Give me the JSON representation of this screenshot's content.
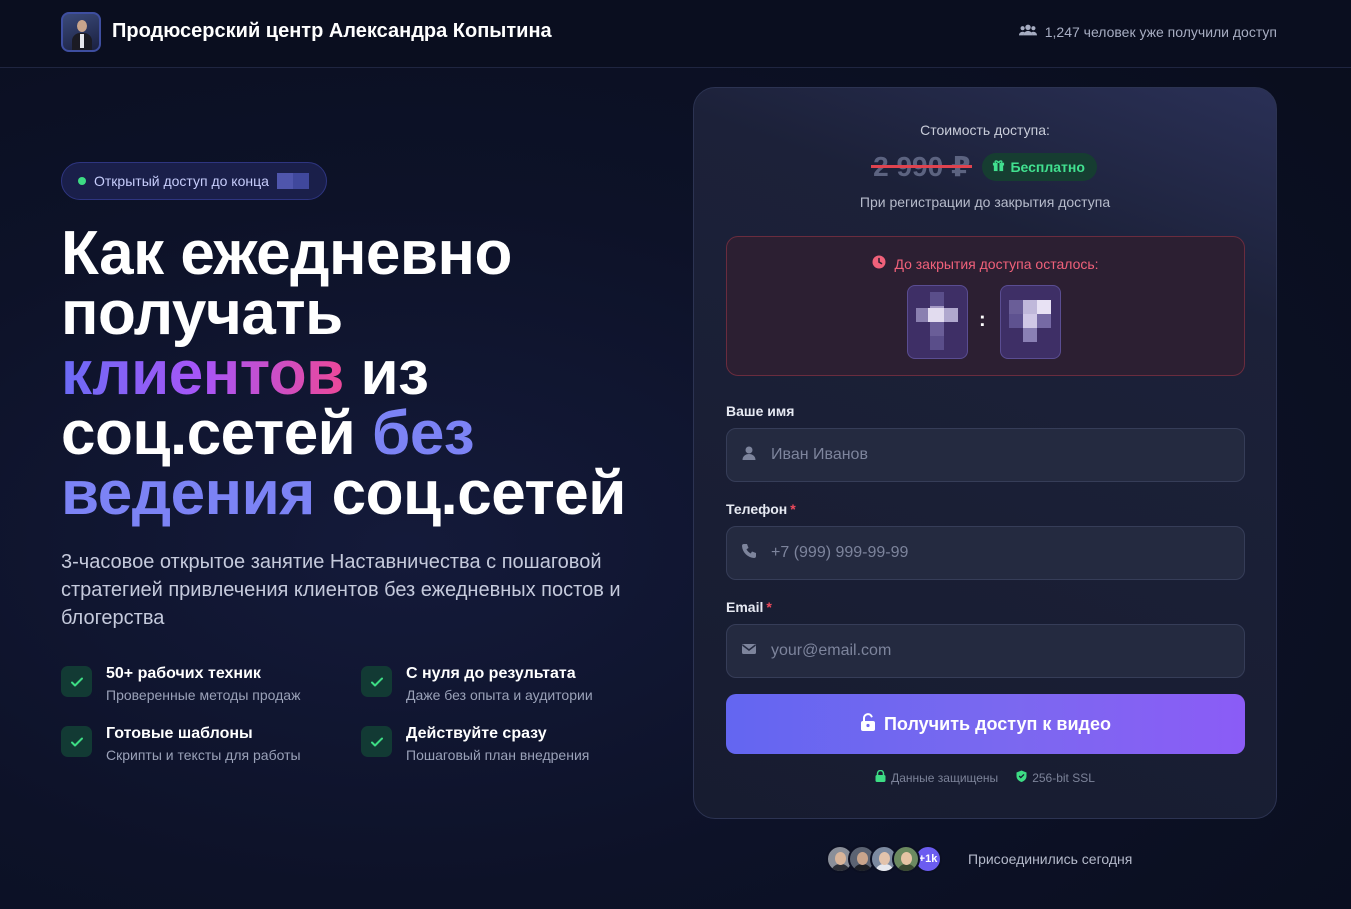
{
  "header": {
    "brand": "Продюсерский центр Александра Копытина",
    "users_count": "1,247 человек уже получили доступ",
    "users_icon": "users-icon"
  },
  "hero": {
    "badge_text": "Открытый доступ до конца",
    "headline": {
      "line1": "Как ежедневно",
      "line2": "получать",
      "line3_gradient": "клиентов",
      "line3_rest": " из",
      "line4_plain": "соц.сетей ",
      "line4_accent": "без",
      "line5_accent": "ведения",
      "line5_plain": " соц.сетей"
    },
    "subtitle": "3-часовое открытое занятие Наставничества с пошаговой стратегией привлечения клиентов без ежедневных постов и блогерства"
  },
  "features": [
    {
      "title": "50+ рабочих техник",
      "desc": "Проверенные методы продаж"
    },
    {
      "title": "С нуля до результата",
      "desc": "Даже без опыта и аудитории"
    },
    {
      "title": "Готовые шаблоны",
      "desc": "Скрипты и тексты для работы"
    },
    {
      "title": "Действуйте сразу",
      "desc": "Пошаговый план внедрения"
    }
  ],
  "card": {
    "price_label": "Стоимость доступа:",
    "old_price": "2 990 ₽",
    "free_label": "Бесплатно",
    "price_note": "При регистрации до закрытия доступа",
    "timer_label": "До закрытия доступа осталось:",
    "timer_sep": ":",
    "form": {
      "name_label": "Ваше имя",
      "name_placeholder": "Иван Иванов",
      "phone_label": "Телефон",
      "phone_placeholder": "+7 (999) 999-99-99",
      "email_label": "Email",
      "email_placeholder": "your@email.com",
      "required_mark": "*"
    },
    "cta_label": "Получить доступ к видео",
    "secure_1": "Данные защищены",
    "secure_2": "256-bit SSL"
  },
  "social_proof": {
    "more_label": "+1k",
    "joined_label": "Присоединились сегодня"
  },
  "colors": {
    "accent": "#7c83f5",
    "cta": "#6366f1",
    "success": "#41e08f",
    "danger": "#ef4a5c"
  }
}
